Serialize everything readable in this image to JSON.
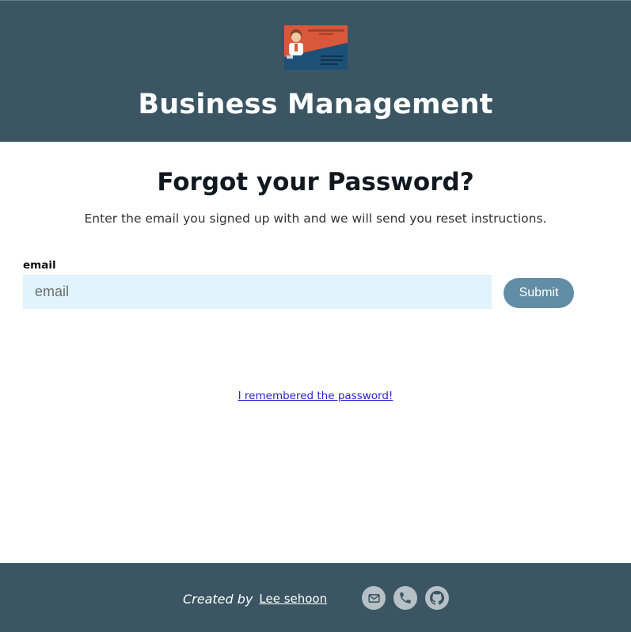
{
  "header": {
    "brand_title": "Business Management",
    "logo_icon": "business-card-icon"
  },
  "main": {
    "heading": "Forgot your Password?",
    "subtext": "Enter the email you signed up with and we will send you reset instructions.",
    "email_label": "email",
    "email_placeholder": "email",
    "email_value": "",
    "submit_label": "Submit",
    "remember_link": "I remembered the password!"
  },
  "footer": {
    "created_by": "Created by",
    "author": "Lee sehoon",
    "icons": [
      "mail-icon",
      "phone-icon",
      "github-icon"
    ]
  },
  "colors": {
    "header_bg": "#3b5563",
    "input_bg": "#e1f3fc",
    "button_bg": "#628ea5",
    "link": "#2b1fd6",
    "footer_icon_bg": "#b7c0c5"
  }
}
